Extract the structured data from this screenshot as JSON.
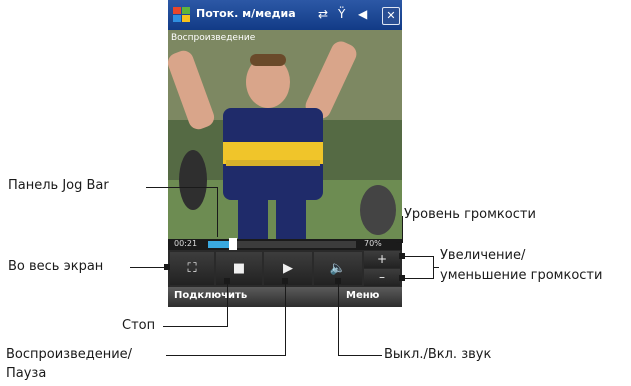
{
  "device": {
    "title": "Поток. м/медиа",
    "status_icons": [
      "sync-icon",
      "signal-off-icon",
      "speaker-icon",
      "close-icon"
    ],
    "video_label": "Воспроизведение",
    "elapsed_time": "00:21",
    "playback_progress_fraction": 0.17,
    "volume_text": "70%",
    "controls": {
      "volume_up": "+",
      "volume_down": "–"
    },
    "softkeys": {
      "left": "Подключить",
      "right": "Меню"
    }
  },
  "callouts": {
    "jog_bar": "Панель Jog Bar",
    "fullscreen": "Во весь экран",
    "stop": "Стоп",
    "play_pause_line1": "Воспроизведение/",
    "play_pause_line2": "Пауза",
    "volume_level": "Уровень громкости",
    "volume_updown_line1": "Увеличение/",
    "volume_updown_line2": "уменьшение громкости",
    "mute": "Выкл./Вкл. звук"
  },
  "colors": {
    "title_bar": "#1f4a98",
    "progress_fill": "#3aa9e0",
    "control_bar": "#2a2a2a"
  }
}
